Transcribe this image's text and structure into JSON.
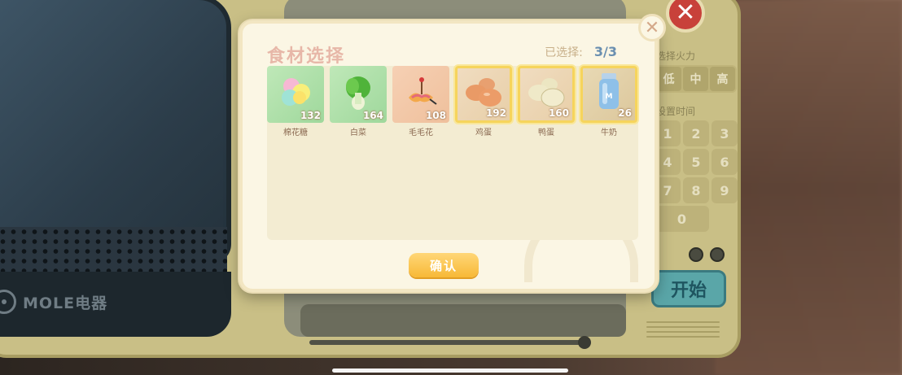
{
  "oven": {
    "brand": "MOLE电器",
    "panel": {
      "close_label": "✕",
      "fire_label": "选择火力",
      "fire_options": [
        "低",
        "中",
        "高"
      ],
      "time_label": "设置时间",
      "keys": [
        "1",
        "2",
        "3",
        "4",
        "5",
        "6",
        "7",
        "8",
        "9",
        "0"
      ],
      "start_label": "开始"
    }
  },
  "dialog": {
    "title": "食材选择",
    "selected_label": "已选择:",
    "selected_count": "3/3",
    "close_label": "✕",
    "confirm_label": "确认",
    "items": [
      {
        "name": "棉花糖",
        "count": "132",
        "selected": false,
        "icon": "marshmallow-icon"
      },
      {
        "name": "白菜",
        "count": "164",
        "selected": false,
        "icon": "cabbage-icon"
      },
      {
        "name": "毛毛花",
        "count": "108",
        "selected": false,
        "icon": "flower-icon"
      },
      {
        "name": "鸡蛋",
        "count": "192",
        "selected": true,
        "icon": "egg-icon"
      },
      {
        "name": "鸭蛋",
        "count": "160",
        "selected": true,
        "icon": "duck-egg-icon"
      },
      {
        "name": "牛奶",
        "count": "26",
        "selected": true,
        "icon": "milk-icon"
      }
    ]
  },
  "colors": {
    "selected_border": "#f6d45c",
    "confirm_button": "#f7b937",
    "title_text": "#e7b7a8",
    "count_text": "#6a8fb0"
  }
}
